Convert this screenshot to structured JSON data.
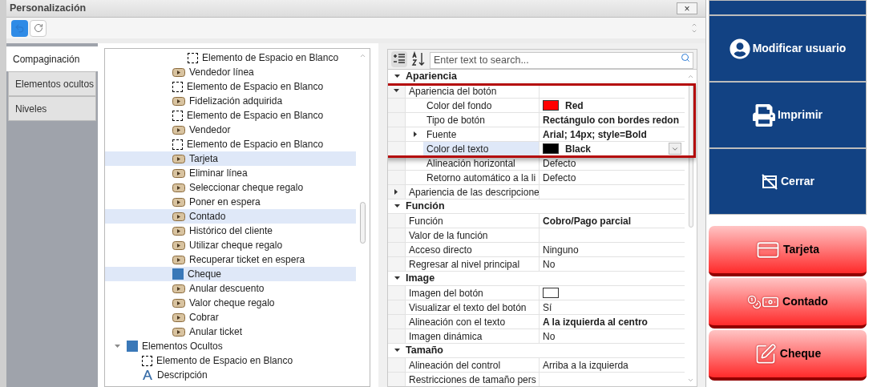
{
  "window": {
    "title": "Personalización",
    "close": "×"
  },
  "toolbar": {
    "undo_active": true
  },
  "tabs": [
    {
      "label": "Compaginación",
      "selected": true
    },
    {
      "label": "Elementos ocultos",
      "selected": false
    },
    {
      "label": "Niveles",
      "selected": false
    }
  ],
  "tree": [
    {
      "children": [
        {
          "children": [
            {
              "children": [
                {
                  "children": [
                    {
                      "label": "Elemento de Espacio en Blanco",
                      "kind": "blank",
                      "selected": false
                    }
                  ]
                },
                {
                  "label": "Vendedor línea",
                  "kind": "action",
                  "selected": false
                },
                {
                  "label": "Elemento de Espacio en Blanco",
                  "kind": "blank",
                  "selected": false
                },
                {
                  "label": "Fidelización adquirida",
                  "kind": "action",
                  "selected": false
                },
                {
                  "label": "Elemento de Espacio en Blanco",
                  "kind": "blank",
                  "selected": false
                },
                {
                  "label": "Vendedor",
                  "kind": "action",
                  "selected": false
                },
                {
                  "label": "Elemento de Espacio en Blanco",
                  "kind": "blank",
                  "selected": false
                },
                {
                  "label": "Tarjeta",
                  "kind": "action",
                  "selected": true
                },
                {
                  "label": "Eliminar línea",
                  "kind": "action",
                  "selected": false
                },
                {
                  "label": "Seleccionar cheque regalo",
                  "kind": "action",
                  "selected": false
                },
                {
                  "label": "Poner en espera",
                  "kind": "action",
                  "selected": false
                },
                {
                  "label": "Contado",
                  "kind": "action",
                  "selected": true
                },
                {
                  "label": "Histórico del cliente",
                  "kind": "action",
                  "selected": false
                },
                {
                  "label": "Utilizar cheque regalo",
                  "kind": "action",
                  "selected": false
                },
                {
                  "label": "Recuperar ticket en espera",
                  "kind": "action",
                  "selected": false
                },
                {
                  "label": "Cheque",
                  "kind": "square",
                  "selected": true
                },
                {
                  "label": "Anular descuento",
                  "kind": "action",
                  "selected": false
                },
                {
                  "label": "Valor cheque regalo",
                  "kind": "action",
                  "selected": false
                },
                {
                  "label": "Cobrar",
                  "kind": "action",
                  "selected": false
                },
                {
                  "label": "Anular ticket",
                  "kind": "action",
                  "selected": false
                }
              ]
            }
          ]
        }
      ]
    },
    {
      "label": "Elementos Ocultos",
      "kind": "square",
      "selected": false,
      "expanded": true,
      "children": [
        {
          "label": "Elemento de Espacio en Blanco",
          "kind": "blank",
          "selected": false
        },
        {
          "label": "Descripción",
          "kind": "text",
          "selected": false
        }
      ]
    }
  ],
  "properties": {
    "search": {
      "placeholder": "Enter text to search..."
    },
    "rows": [
      {
        "label": "Apariencia",
        "kind": "category",
        "expanded": true,
        "children": [
          {
            "label": "Apariencia del botón",
            "kind": "group",
            "expanded": true,
            "highlighted": true,
            "children": [
              {
                "label": "Color del fondo",
                "kind": "property",
                "highlighted": true,
                "selected": false,
                "value": {
                  "text": "Red",
                  "color": "#ff0000",
                  "bold": true
                }
              },
              {
                "label": "Tipo de botón",
                "kind": "property",
                "highlighted": true,
                "selected": false,
                "value": {
                  "text": "Rectángulo con bordes redon",
                  "bold": true
                }
              },
              {
                "label": "Fuente",
                "kind": "group",
                "expanded": false,
                "highlighted": true,
                "selected": false,
                "value": {
                  "text": "Arial; 14px; style=Bold",
                  "bold": true
                }
              },
              {
                "label": "Color del texto",
                "kind": "property",
                "highlighted": true,
                "selected": true,
                "value": {
                  "text": "Black",
                  "color": "#000000",
                  "bold": true
                }
              },
              {
                "label": "Alineación horizontal",
                "kind": "property",
                "selected": false,
                "value": {
                  "text": "Defecto",
                  "bold": false
                }
              },
              {
                "label": "Retorno automático a la li",
                "kind": "property",
                "selected": false,
                "value": {
                  "text": "Defecto",
                  "bold": false
                }
              }
            ]
          },
          {
            "label": "Apariencia de las descripcione",
            "kind": "group",
            "expanded": false
          }
        ]
      },
      {
        "label": "Función",
        "kind": "category",
        "expanded": true,
        "children": [
          {
            "label": "Función",
            "kind": "property",
            "selected": false,
            "value": {
              "text": "Cobro/Pago parcial",
              "bold": true
            }
          },
          {
            "label": "Valor de la función",
            "kind": "property",
            "selected": false
          },
          {
            "label": "Acceso directo",
            "kind": "property",
            "selected": false,
            "value": {
              "text": "Ninguno",
              "bold": false
            }
          },
          {
            "label": "Regresar al nivel principal",
            "kind": "property",
            "selected": false,
            "value": {
              "text": "No",
              "bold": false
            }
          }
        ]
      },
      {
        "label": "Image",
        "kind": "category",
        "expanded": true,
        "children": [
          {
            "label": "Imagen del botón",
            "kind": "property",
            "selected": false,
            "value": {
              "color": "#ffffff"
            }
          },
          {
            "label": "Visualizar el texto del botón",
            "kind": "property",
            "selected": false,
            "value": {
              "text": "Sí",
              "bold": false
            }
          },
          {
            "label": "Alineación con el texto",
            "kind": "property",
            "selected": false,
            "value": {
              "text": "A la izquierda al centro",
              "bold": true
            }
          },
          {
            "label": "Imagen dinámica",
            "kind": "property",
            "selected": false,
            "value": {
              "text": "No",
              "bold": false
            }
          }
        ]
      },
      {
        "label": "Tamaño",
        "kind": "category",
        "expanded": true,
        "children": [
          {
            "label": "Alineación del control",
            "kind": "property",
            "selected": false,
            "value": {
              "text": "Arriba a la izquierda",
              "bold": false
            }
          },
          {
            "label": "Restricciones de tamaño pers",
            "kind": "property",
            "selected": false
          }
        ]
      }
    ]
  },
  "side_buttons": [
    {
      "kind": "blue"
    },
    {
      "kind": "blue",
      "label": "Modificar usuario"
    },
    {
      "kind": "blue",
      "label": "Imprimir"
    },
    {
      "kind": "blue",
      "label": "Cerrar"
    },
    {
      "kind": "gap"
    },
    {
      "kind": "red",
      "label": "Tarjeta"
    },
    {
      "kind": "red",
      "label": "Contado"
    },
    {
      "kind": "red",
      "label": "Cheque"
    }
  ]
}
